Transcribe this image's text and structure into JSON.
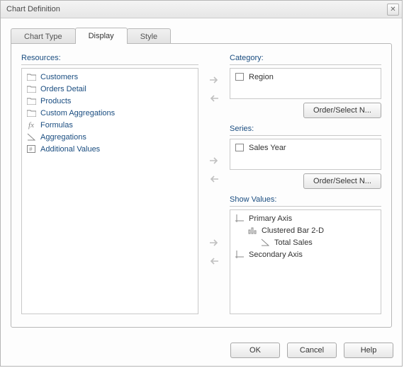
{
  "window": {
    "title": "Chart Definition",
    "close_glyph": "✕"
  },
  "tabs": {
    "chart_type": "Chart Type",
    "display": "Display",
    "style": "Style"
  },
  "resources": {
    "label": "Resources:",
    "items": {
      "customers": "Customers",
      "orders_detail": "Orders Detail",
      "products": "Products",
      "custom_aggregations": "Custom Aggregations",
      "formulas": "Formulas",
      "aggregations": "Aggregations",
      "additional_values": "Additional Values"
    }
  },
  "category": {
    "label": "Category:",
    "item": "Region",
    "order_button": "Order/Select N..."
  },
  "series": {
    "label": "Series:",
    "item": "Sales Year",
    "order_button": "Order/Select N..."
  },
  "show_values": {
    "label": "Show Values:",
    "primary_axis": "Primary Axis",
    "clustered_bar": "Clustered Bar 2-D",
    "total_sales": "Total Sales",
    "secondary_axis": "Secondary Axis"
  },
  "buttons": {
    "ok": "OK",
    "cancel": "Cancel",
    "help": "Help"
  }
}
